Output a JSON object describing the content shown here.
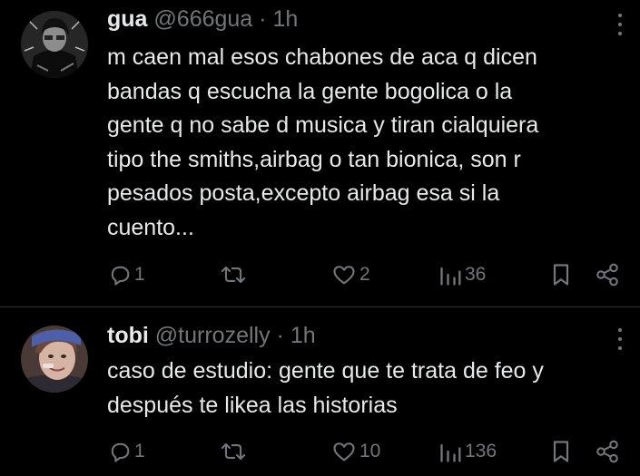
{
  "colors": {
    "background": "#000000",
    "text_primary": "#e7e9ea",
    "text_secondary": "#71767b",
    "divider": "#2f3336"
  },
  "tweets": [
    {
      "author_name": "gua",
      "handle": "@666gua",
      "separator": "·",
      "time": "1h",
      "text_lines": [
        "m caen mal esos chabones de aca q dicen",
        "bandas q escucha la gente bogolica o la",
        "gente q no sabe d musica y tiran cialquiera",
        "tipo the smiths,airbag o tan bionica, son r",
        "pesados posta,excepto airbag esa si la",
        "cuento..."
      ],
      "replies": "1",
      "reposts": "",
      "likes": "2",
      "views": "36",
      "icons": [
        "reply-icon",
        "repost-icon",
        "like-icon",
        "views-icon",
        "bookmark-icon",
        "share-icon",
        "more-icon"
      ]
    },
    {
      "author_name": "tobi",
      "handle": "@turrozelly",
      "separator": "·",
      "time": "1h",
      "text_lines": [
        "caso de estudio: gente que te trata de feo y",
        "después te likea las historias"
      ],
      "replies": "1",
      "reposts": "",
      "likes": "10",
      "views": "136",
      "icons": [
        "reply-icon",
        "repost-icon",
        "like-icon",
        "views-icon",
        "bookmark-icon",
        "share-icon",
        "more-icon"
      ]
    }
  ]
}
